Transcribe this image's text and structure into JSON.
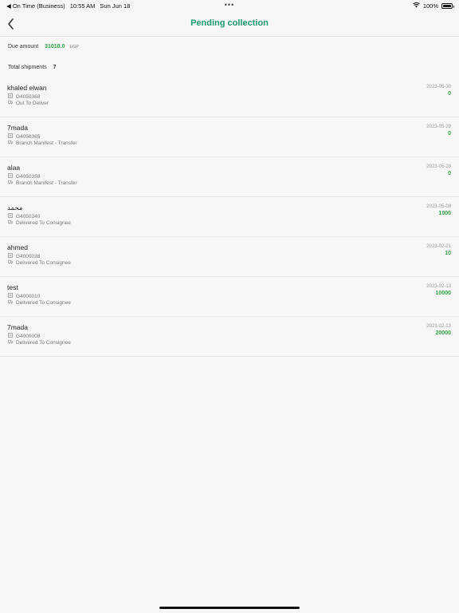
{
  "status_bar": {
    "back_app": "◀ On Time (Business)",
    "time": "10:55 AM",
    "date": "Sun Jun 18",
    "dots": "•••",
    "battery": "100%"
  },
  "nav": {
    "title": "Pending collection"
  },
  "summary": {
    "due_label": "Due amount",
    "due_value": "31010.0",
    "due_unit": "EGP",
    "total_label": "Total shipments",
    "total_value": "7"
  },
  "shipments": [
    {
      "name": "khaled elwan",
      "id": "G4050368",
      "status": "Out To Deliver",
      "date": "2023-05-30",
      "amount": "0"
    },
    {
      "name": "7mada",
      "id": "G4050365",
      "status": "Branch Manifest - Transfer",
      "date": "2023-05-29",
      "amount": "0"
    },
    {
      "name": "alaa",
      "id": "G4050358",
      "status": "Branch Manifest - Transfer",
      "date": "2023-05-28",
      "amount": "0"
    },
    {
      "name": "محمد",
      "id": "G4050240",
      "status": "Delivered To Consignee",
      "date": "2023-05-08",
      "amount": "1000"
    },
    {
      "name": "ahmed",
      "id": "G4000038",
      "status": "Delivered To Consignee",
      "date": "2023-02-21",
      "amount": "10"
    },
    {
      "name": "test",
      "id": "G4000010",
      "status": "Delivered To Consignee",
      "date": "2023-02-13",
      "amount": "10000"
    },
    {
      "name": "7mada",
      "id": "G4000008",
      "status": "Delivered To Consignee",
      "date": "2023-02-13",
      "amount": "20000"
    }
  ],
  "colors": {
    "accent": "#1f9a6a",
    "amount_green": "#2ea043"
  }
}
